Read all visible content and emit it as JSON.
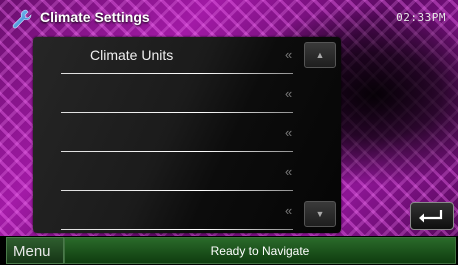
{
  "header": {
    "title": "Climate Settings",
    "clock": "02:33PM",
    "icon": "wrench-icon"
  },
  "settings": {
    "rows": [
      {
        "label": "Climate Units"
      },
      {
        "label": ""
      },
      {
        "label": ""
      },
      {
        "label": ""
      },
      {
        "label": ""
      }
    ],
    "chevron": "«",
    "scroll_up": "▲",
    "scroll_down": "▼"
  },
  "footer": {
    "menu_label": "Menu",
    "status": "Ready to Navigate"
  },
  "colors": {
    "wallpaper": "#a21aa6",
    "status_bar": "#2a6a2a",
    "panel": "#1b1b1b"
  }
}
